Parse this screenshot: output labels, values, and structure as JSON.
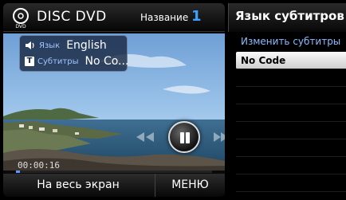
{
  "header": {
    "disc_label": "DISC DVD",
    "name_label": "Название",
    "name_value": "1"
  },
  "info": {
    "language_label": "Язык",
    "language_value": "English",
    "subtitle_label": "Субтитры",
    "subtitle_value": "No Co..."
  },
  "playback": {
    "time": "00:00:16",
    "progress_fraction": 0.02
  },
  "bottom": {
    "fullscreen_label": "На весь экран",
    "menu_label": "МЕНЮ"
  },
  "subtitle_panel": {
    "title": "Язык субтитров",
    "action": "Изменить субтитры",
    "items": [
      {
        "label": "No Code",
        "selected": true
      },
      {
        "label": "",
        "selected": false
      },
      {
        "label": "",
        "selected": false
      },
      {
        "label": "",
        "selected": false
      },
      {
        "label": "",
        "selected": false
      },
      {
        "label": "",
        "selected": false
      },
      {
        "label": "",
        "selected": false
      },
      {
        "label": "",
        "selected": false
      }
    ]
  },
  "icons": {
    "disc": "disc-icon",
    "speaker": "speaker-icon",
    "subtitle": "subtitle-t-icon",
    "pause": "pause-icon",
    "rewind": "rewind-icon",
    "fast_forward": "fast-forward-icon"
  },
  "colors": {
    "accent_blue": "#3ea0ff",
    "menu_text_blue": "#8cbcff",
    "selected_item_bg": "#f0f0f0"
  }
}
